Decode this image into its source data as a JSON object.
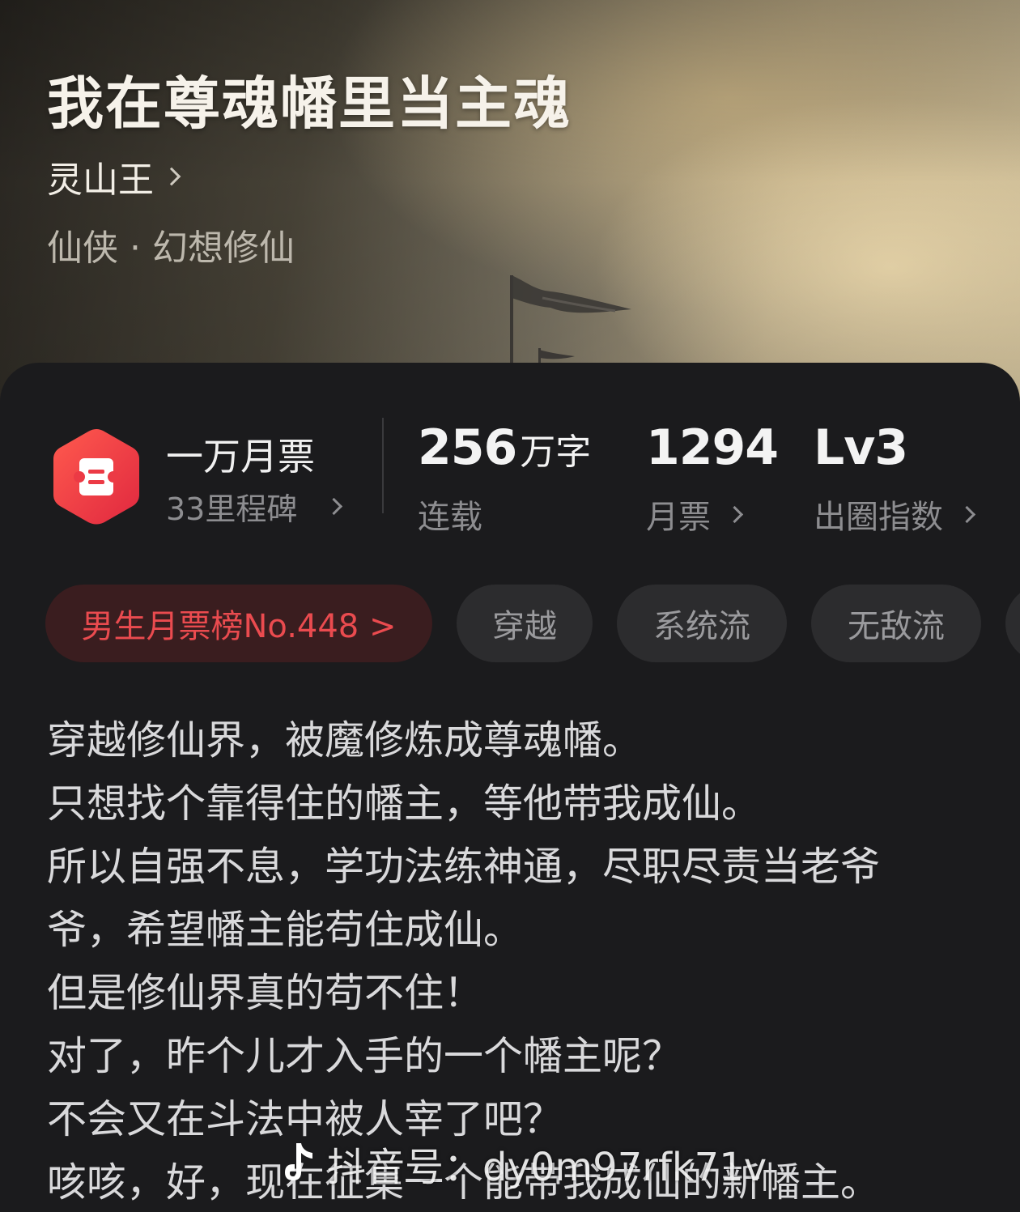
{
  "book": {
    "title": "我在尊魂幡里当主魂",
    "author": "灵山王",
    "genre": "仙侠 · 幻想修仙"
  },
  "milestone": {
    "title": "一万月票",
    "subtitle": "33里程碑"
  },
  "stats": [
    {
      "value": "256",
      "unit": "万字",
      "label": "连载",
      "has_arrow": false
    },
    {
      "value": "1294",
      "unit": "",
      "label": "月票",
      "has_arrow": true
    },
    {
      "value": "Lv3",
      "unit": "",
      "label": "出圈指数",
      "has_arrow": true
    }
  ],
  "tags": {
    "rank": "男生月票榜No.448 >",
    "items": [
      "穿越",
      "系统流",
      "无敌流",
      ""
    ]
  },
  "synopsis": [
    "穿越修仙界，被魔修炼成尊魂幡。",
    "只想找个靠得住的幡主，等他带我成仙。",
    "所以自强不息，学功法练神通，尽职尽责当老爷",
    "爷，希望幡主能苟住成仙。",
    "但是修仙界真的苟不住！",
    "对了，昨个儿才入手的一个幡主呢？",
    "不会又在斗法中被人宰了吧？",
    "咳咳，好，现在征集一个能带我成仙的新幡主。"
  ],
  "watermark": "抖音号：dy0m97rfk71v",
  "colors": {
    "accent_red": "#ea4b4f",
    "panel_bg": "#1b1b1d",
    "tag_bg": "#2c2c2e"
  }
}
